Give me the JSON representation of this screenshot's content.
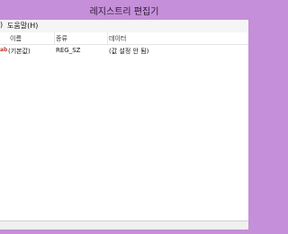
{
  "window": {
    "title": "레지스트리 편집기"
  },
  "menubar": {
    "items": [
      {
        "label": ")"
      },
      {
        "label": "도움말(H)"
      }
    ]
  },
  "list": {
    "columns": [
      {
        "label": "이름"
      },
      {
        "label": "종류"
      },
      {
        "label": "데이터"
      }
    ],
    "rows": [
      {
        "name": "(기본값)",
        "type": "REG_SZ",
        "data": "(값 설정 안 됨)"
      }
    ]
  },
  "colors": {
    "frame": "#c58fd9",
    "accent_icon": "#c0392b"
  },
  "icons": {
    "value_icon": "ab-string-value-icon"
  }
}
